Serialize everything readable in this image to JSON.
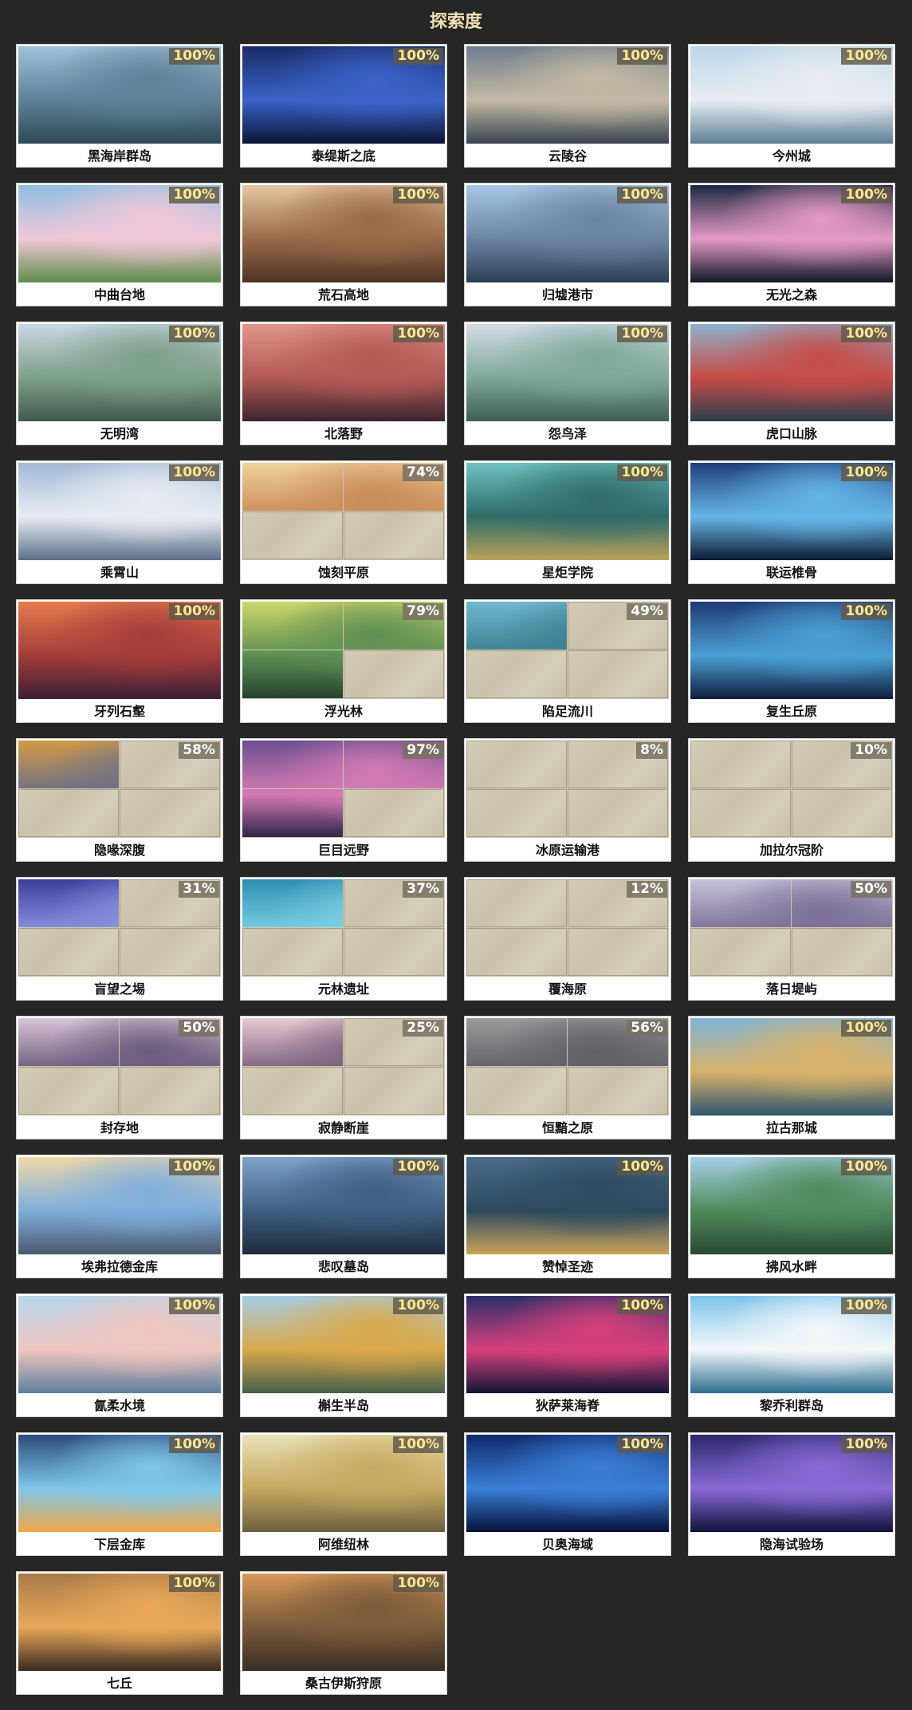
{
  "page": {
    "title": "探索度"
  },
  "regions": [
    {
      "name": "黑海岸群岛",
      "percent": "100%",
      "progress": 100,
      "revealed": 4,
      "colors": [
        "#9fc3dc",
        "#5f8196",
        "#2f4a57"
      ]
    },
    {
      "name": "泰缇斯之底",
      "percent": "100%",
      "progress": 100,
      "revealed": 4,
      "colors": [
        "#1a2b66",
        "#3a63c9",
        "#0d1537"
      ]
    },
    {
      "name": "云陵谷",
      "percent": "100%",
      "progress": 100,
      "revealed": 4,
      "colors": [
        "#6f7d8d",
        "#c4b9a4",
        "#3a4652"
      ]
    },
    {
      "name": "今州城",
      "percent": "100%",
      "progress": 100,
      "revealed": 4,
      "colors": [
        "#bcd5e8",
        "#e8eef2",
        "#5d7e96"
      ]
    },
    {
      "name": "中曲台地",
      "percent": "100%",
      "progress": 100,
      "revealed": 4,
      "colors": [
        "#8fc0e3",
        "#f1c8d8",
        "#5e8d4a"
      ]
    },
    {
      "name": "荒石高地",
      "percent": "100%",
      "progress": 100,
      "revealed": 4,
      "colors": [
        "#e6c8a2",
        "#9a6a49",
        "#4d3426"
      ]
    },
    {
      "name": "归墟港市",
      "percent": "100%",
      "progress": 100,
      "revealed": 4,
      "colors": [
        "#a8c8e4",
        "#6c84a3",
        "#2c3f55"
      ]
    },
    {
      "name": "无光之森",
      "percent": "100%",
      "progress": 100,
      "revealed": 4,
      "colors": [
        "#1d2842",
        "#e49ac3",
        "#101828"
      ]
    },
    {
      "name": "无明湾",
      "percent": "100%",
      "progress": 100,
      "revealed": 4,
      "colors": [
        "#c9d8e6",
        "#7ea089",
        "#3f5a4b"
      ]
    },
    {
      "name": "北落野",
      "percent": "100%",
      "progress": 100,
      "revealed": 4,
      "colors": [
        "#e0958c",
        "#b35a55",
        "#3b2430"
      ]
    },
    {
      "name": "怨鸟泽",
      "percent": "100%",
      "progress": 100,
      "revealed": 4,
      "colors": [
        "#d4dde6",
        "#7fa89b",
        "#405d55"
      ]
    },
    {
      "name": "虎口山脉",
      "percent": "100%",
      "progress": 100,
      "revealed": 4,
      "colors": [
        "#8eb2ce",
        "#c64c47",
        "#2d3d4f"
      ]
    },
    {
      "name": "乘霄山",
      "percent": "100%",
      "progress": 100,
      "revealed": 4,
      "colors": [
        "#a2b9d6",
        "#e8edf3",
        "#5c6f8a"
      ]
    },
    {
      "name": "蚀刻平原",
      "percent": "74%",
      "progress": 74,
      "revealed": 2,
      "colors": [
        "#f0d29a",
        "#c98b5a",
        "#6d4f44"
      ]
    },
    {
      "name": "星炬学院",
      "percent": "100%",
      "progress": 100,
      "revealed": 4,
      "colors": [
        "#6fc2c2",
        "#2f6b69",
        "#b9a35a"
      ]
    },
    {
      "name": "联运椎骨",
      "percent": "100%",
      "progress": 100,
      "revealed": 4,
      "colors": [
        "#1f3f7a",
        "#66b6e8",
        "#0d1b33"
      ]
    },
    {
      "name": "牙列石壑",
      "percent": "100%",
      "progress": 100,
      "revealed": 4,
      "colors": [
        "#e87b4d",
        "#a33d3a",
        "#3a1f36"
      ]
    },
    {
      "name": "浮光林",
      "percent": "79%",
      "progress": 79,
      "revealed": 3,
      "colors": [
        "#cfd76a",
        "#5e8f53",
        "#24412e"
      ]
    },
    {
      "name": "陷足流川",
      "percent": "49%",
      "progress": 49,
      "revealed": 1,
      "colors": [
        "#6fb7d0",
        "#3a7f8f",
        "#2b4a55"
      ]
    },
    {
      "name": "复生丘原",
      "percent": "100%",
      "progress": 100,
      "revealed": 4,
      "colors": [
        "#1f3a72",
        "#4aa0d6",
        "#0f1d3b"
      ]
    },
    {
      "name": "隐喙深腹",
      "percent": "58%",
      "progress": 58,
      "revealed": 1,
      "colors": [
        "#d39a45",
        "#6a6f89",
        "#3b3a40"
      ]
    },
    {
      "name": "巨目远野",
      "percent": "97%",
      "progress": 97,
      "revealed": 3,
      "colors": [
        "#6a4f8f",
        "#d57ab3",
        "#2b2447"
      ]
    },
    {
      "name": "冰原运输港",
      "percent": "8%",
      "progress": 8,
      "revealed": 0,
      "colors": [
        "#cfc6b0",
        "#cfc6b0",
        "#cfc6b0"
      ]
    },
    {
      "name": "加拉尔冠阶",
      "percent": "10%",
      "progress": 10,
      "revealed": 0,
      "colors": [
        "#cfc6b0",
        "#cfc6b0",
        "#cfc6b0"
      ]
    },
    {
      "name": "盲望之埸",
      "percent": "31%",
      "progress": 31,
      "revealed": 1,
      "colors": [
        "#3b3f9e",
        "#8c95e0",
        "#151a45"
      ]
    },
    {
      "name": "元林遗址",
      "percent": "37%",
      "progress": 37,
      "revealed": 1,
      "colors": [
        "#2f8fb0",
        "#7ad0e6",
        "#143649"
      ]
    },
    {
      "name": "覆海原",
      "percent": "12%",
      "progress": 12,
      "revealed": 0,
      "colors": [
        "#cfc6b0",
        "#cfc6b0",
        "#cfc6b0"
      ]
    },
    {
      "name": "落日堤屿",
      "percent": "50%",
      "progress": 50,
      "revealed": 2,
      "colors": [
        "#c6c2d8",
        "#7c6f96",
        "#3b3452"
      ]
    },
    {
      "name": "封存地",
      "percent": "50%",
      "progress": 50,
      "revealed": 2,
      "colors": [
        "#d8c4d6",
        "#6a5a7c",
        "#2a2436"
      ]
    },
    {
      "name": "寂静断崖",
      "percent": "25%",
      "progress": 25,
      "revealed": 1,
      "colors": [
        "#e8c8d2",
        "#7a5f7e",
        "#3b2f44"
      ]
    },
    {
      "name": "恒黯之原",
      "percent": "56%",
      "progress": 56,
      "revealed": 2,
      "colors": [
        "#9a9a9c",
        "#5f6066",
        "#2e3036"
      ]
    },
    {
      "name": "拉古那城",
      "percent": "100%",
      "progress": 100,
      "revealed": 4,
      "colors": [
        "#7fb3d6",
        "#d8b26a",
        "#2f5670"
      ]
    },
    {
      "name": "埃弗拉德金库",
      "percent": "100%",
      "progress": 100,
      "revealed": 4,
      "colors": [
        "#f0d8a8",
        "#7faedc",
        "#4a5a6c"
      ]
    },
    {
      "name": "悲叹墓岛",
      "percent": "100%",
      "progress": 100,
      "revealed": 4,
      "colors": [
        "#7fa3c8",
        "#3f5f82",
        "#1c2b3d"
      ]
    },
    {
      "name": "赞悼圣迹",
      "percent": "100%",
      "progress": 100,
      "revealed": 4,
      "colors": [
        "#4a6a8a",
        "#2e4a5e",
        "#c9a45a"
      ]
    },
    {
      "name": "拂风水畔",
      "percent": "100%",
      "progress": 100,
      "revealed": 4,
      "colors": [
        "#a8d0e8",
        "#4f8a5a",
        "#2a4a35"
      ]
    },
    {
      "name": "氤柔水境",
      "percent": "100%",
      "progress": 100,
      "revealed": 4,
      "colors": [
        "#b8d6ec",
        "#f0c6c0",
        "#5f7f9c"
      ]
    },
    {
      "name": "槲生半岛",
      "percent": "100%",
      "progress": 100,
      "revealed": 4,
      "colors": [
        "#a7cde6",
        "#d8a84a",
        "#46604a"
      ]
    },
    {
      "name": "狄萨莱海脊",
      "percent": "100%",
      "progress": 100,
      "revealed": 4,
      "colors": [
        "#2a2f6a",
        "#d8407a",
        "#0f1638"
      ]
    },
    {
      "name": "黎乔利群岛",
      "percent": "100%",
      "progress": 100,
      "revealed": 4,
      "colors": [
        "#7ec3ea",
        "#f4f8fb",
        "#2d6f8f"
      ]
    },
    {
      "name": "下层金库",
      "percent": "100%",
      "progress": 100,
      "revealed": 4,
      "colors": [
        "#2a4a7a",
        "#7fc6ea",
        "#f0a848"
      ]
    },
    {
      "name": "阿维纽林",
      "percent": "100%",
      "progress": 100,
      "revealed": 4,
      "colors": [
        "#e8e2b8",
        "#c8a860",
        "#6a6040"
      ]
    },
    {
      "name": "贝奥海域",
      "percent": "100%",
      "progress": 100,
      "revealed": 4,
      "colors": [
        "#0f2a6a",
        "#3a7fd8",
        "#06123a"
      ]
    },
    {
      "name": "隐海试验场",
      "percent": "100%",
      "progress": 100,
      "revealed": 4,
      "colors": [
        "#2a2a6a",
        "#8a6ad8",
        "#10123a"
      ]
    },
    {
      "name": "七丘",
      "percent": "100%",
      "progress": 100,
      "revealed": 4,
      "colors": [
        "#a87a4a",
        "#e8a858",
        "#3a2a22"
      ]
    },
    {
      "name": "桑古伊斯狩原",
      "percent": "100%",
      "progress": 100,
      "revealed": 4,
      "colors": [
        "#d89858",
        "#7a5a3a",
        "#3a2e26"
      ]
    }
  ]
}
